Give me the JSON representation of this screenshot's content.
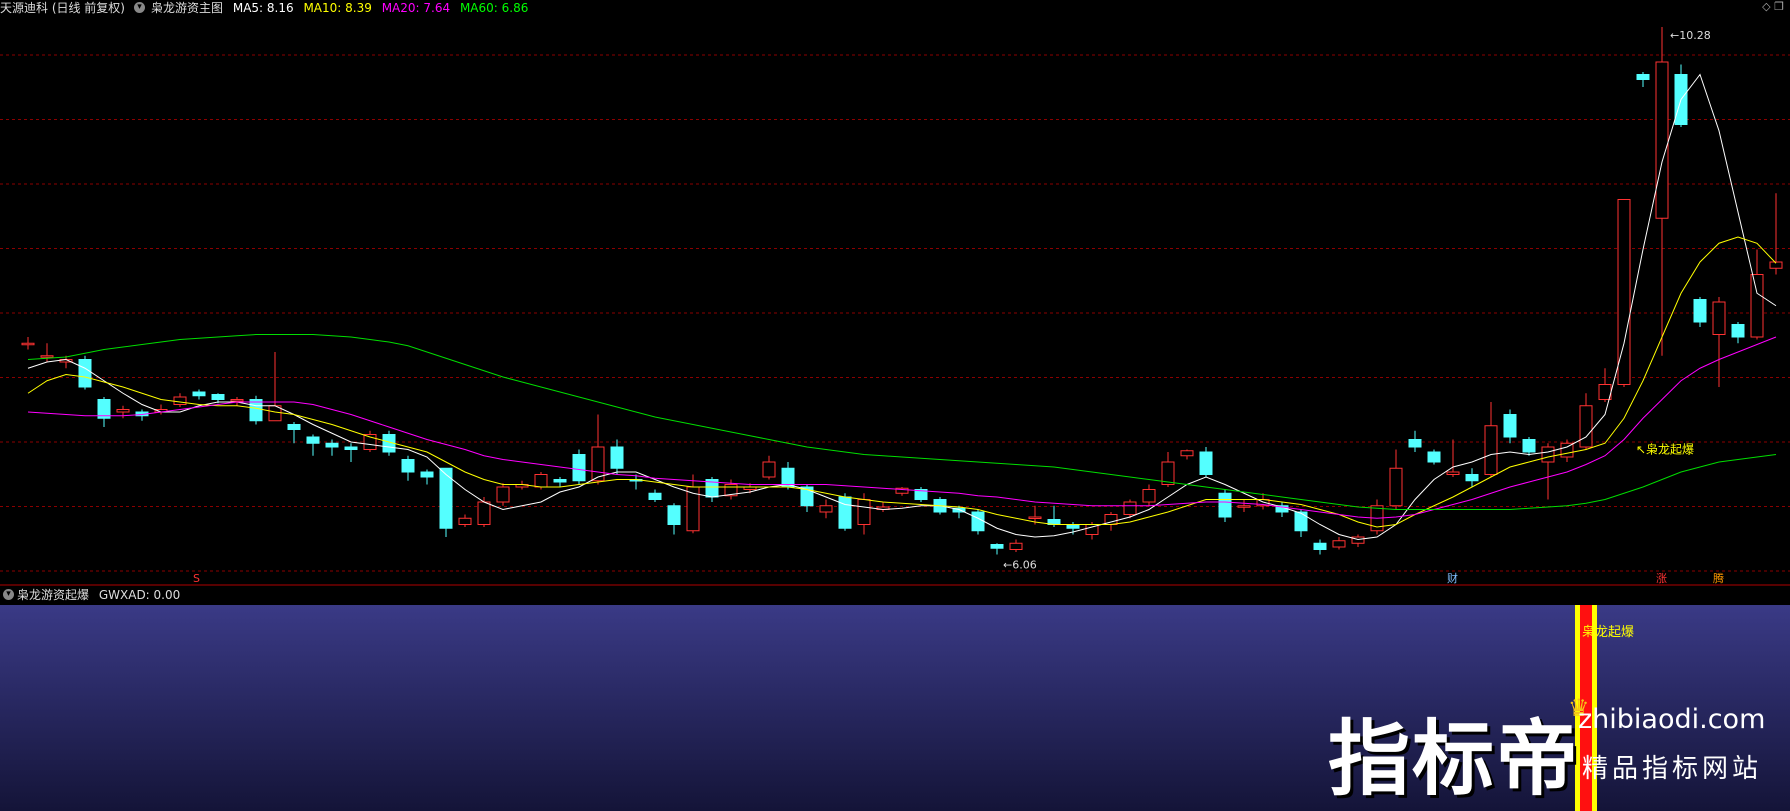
{
  "header": {
    "stock": "天源迪科 (日线 前复权)",
    "indicator": "枭龙游资主图",
    "ma5": {
      "label": "MA5: 8.16",
      "color": "#ffffff"
    },
    "ma10": {
      "label": "MA10: 8.39",
      "color": "#ffff00"
    },
    "ma20": {
      "label": "MA20: 7.64",
      "color": "#ff00ff"
    },
    "ma60": {
      "label": "MA60: 6.86",
      "color": "#00ff00"
    }
  },
  "corner_icons": [
    "diamond-icon",
    "window-icon"
  ],
  "sub_header": {
    "indicator": "枭龙游资起爆",
    "value": "GWXAD: 0.00"
  },
  "annotations": {
    "high": "10.28",
    "low": "6.06",
    "signal": "枭龙起爆",
    "sub_signal": "枭龙起爆",
    "marker_s": "S",
    "marker_cai": "财",
    "marker_zhang": "涨",
    "marker_sheng": "腾"
  },
  "watermark": {
    "brand": "指标帝",
    "url": "zhibiaodi.com",
    "slogan": "精品指标网站"
  },
  "colors": {
    "up": "#ff3232",
    "down": "#54ffff",
    "grid": "#8b0000",
    "signal": "#ffff00"
  },
  "chart_data": {
    "type": "candlestick",
    "ohlc": [
      [
        7.75,
        7.75,
        7.8,
        7.7
      ],
      [
        7.65,
        7.65,
        7.75,
        7.6
      ],
      [
        7.6,
        7.62,
        7.65,
        7.55
      ],
      [
        7.62,
        7.4,
        7.65,
        7.38
      ],
      [
        7.3,
        7.15,
        7.32,
        7.08
      ],
      [
        7.2,
        7.22,
        7.25,
        7.15
      ],
      [
        7.2,
        7.17,
        7.22,
        7.13
      ],
      [
        7.2,
        7.22,
        7.26,
        7.18
      ],
      [
        7.26,
        7.32,
        7.35,
        7.24
      ],
      [
        7.36,
        7.33,
        7.38,
        7.3
      ],
      [
        7.34,
        7.3,
        7.35,
        7.27
      ],
      [
        7.3,
        7.3,
        7.32,
        7.25
      ],
      [
        7.3,
        7.13,
        7.33,
        7.1
      ],
      [
        7.13,
        7.25,
        7.68,
        7.13
      ],
      [
        7.1,
        7.06,
        7.12,
        6.95
      ],
      [
        7.0,
        6.95,
        7.02,
        6.85
      ],
      [
        6.95,
        6.92,
        6.98,
        6.85
      ],
      [
        6.92,
        6.9,
        6.95,
        6.8
      ],
      [
        6.9,
        7.02,
        7.05,
        6.88
      ],
      [
        7.02,
        6.88,
        7.05,
        6.85
      ],
      [
        6.82,
        6.72,
        6.85,
        6.65
      ],
      [
        6.72,
        6.68,
        6.74,
        6.62
      ],
      [
        6.75,
        6.27,
        6.75,
        6.2
      ],
      [
        6.3,
        6.35,
        6.38,
        6.28
      ],
      [
        6.3,
        6.48,
        6.52,
        6.28
      ],
      [
        6.48,
        6.6,
        6.63,
        6.45
      ],
      [
        6.6,
        6.62,
        6.65,
        6.58
      ],
      [
        6.6,
        6.7,
        6.72,
        6.58
      ],
      [
        6.66,
        6.64,
        6.68,
        6.6
      ],
      [
        6.86,
        6.65,
        6.9,
        6.62
      ],
      [
        6.65,
        6.92,
        7.18,
        6.62
      ],
      [
        6.92,
        6.75,
        6.98,
        6.7
      ],
      [
        6.66,
        6.65,
        6.7,
        6.58
      ],
      [
        6.55,
        6.5,
        6.58,
        6.48
      ],
      [
        6.45,
        6.3,
        6.47,
        6.22
      ],
      [
        6.25,
        6.6,
        6.7,
        6.23
      ],
      [
        6.66,
        6.52,
        6.68,
        6.48
      ],
      [
        6.53,
        6.62,
        6.66,
        6.5
      ],
      [
        6.58,
        6.6,
        6.63,
        6.55
      ],
      [
        6.68,
        6.8,
        6.85,
        6.66
      ],
      [
        6.75,
        6.6,
        6.8,
        6.58
      ],
      [
        6.6,
        6.45,
        6.62,
        6.4
      ],
      [
        6.4,
        6.45,
        6.5,
        6.35
      ],
      [
        6.52,
        6.27,
        6.55,
        6.25
      ],
      [
        6.3,
        6.5,
        6.55,
        6.22
      ],
      [
        6.42,
        6.44,
        6.48,
        6.4
      ],
      [
        6.55,
        6.59,
        6.6,
        6.53
      ],
      [
        6.58,
        6.5,
        6.6,
        6.48
      ],
      [
        6.5,
        6.4,
        6.52,
        6.38
      ],
      [
        6.43,
        6.4,
        6.45,
        6.35
      ],
      [
        6.4,
        6.25,
        6.42,
        6.22
      ],
      [
        6.14,
        6.11,
        6.15,
        6.06
      ],
      [
        6.1,
        6.15,
        6.18,
        6.08
      ],
      [
        6.35,
        6.36,
        6.45,
        6.3
      ],
      [
        6.34,
        6.3,
        6.45,
        6.28
      ],
      [
        6.3,
        6.27,
        6.32,
        6.22
      ],
      [
        6.22,
        6.3,
        6.32,
        6.18
      ],
      [
        6.3,
        6.38,
        6.4,
        6.25
      ],
      [
        6.38,
        6.48,
        6.5,
        6.35
      ],
      [
        6.48,
        6.58,
        6.62,
        6.45
      ],
      [
        6.62,
        6.8,
        6.88,
        6.6
      ],
      [
        6.85,
        6.89,
        6.9,
        6.82
      ],
      [
        6.88,
        6.7,
        6.92,
        6.68
      ],
      [
        6.55,
        6.36,
        6.58,
        6.32
      ],
      [
        6.45,
        6.45,
        6.5,
        6.4
      ],
      [
        6.45,
        6.5,
        6.55,
        6.42
      ],
      [
        6.45,
        6.4,
        6.48,
        6.36
      ],
      [
        6.4,
        6.25,
        6.42,
        6.2
      ],
      [
        6.15,
        6.1,
        6.18,
        6.06
      ],
      [
        6.12,
        6.17,
        6.2,
        6.1
      ],
      [
        6.15,
        6.2,
        6.22,
        6.12
      ],
      [
        6.25,
        6.45,
        6.5,
        6.22
      ],
      [
        6.45,
        6.75,
        6.9,
        6.42
      ],
      [
        6.98,
        6.92,
        7.05,
        6.88
      ],
      [
        6.88,
        6.8,
        6.9,
        6.78
      ],
      [
        6.7,
        6.72,
        6.98,
        6.68
      ],
      [
        6.7,
        6.65,
        6.75,
        6.6
      ],
      [
        6.7,
        7.09,
        7.28,
        6.68
      ],
      [
        7.18,
        7.0,
        7.22,
        6.95
      ],
      [
        6.98,
        6.88,
        7.0,
        6.85
      ],
      [
        6.8,
        6.92,
        6.95,
        6.5
      ],
      [
        6.84,
        6.95,
        6.98,
        6.8
      ],
      [
        6.92,
        7.25,
        7.35,
        6.9
      ],
      [
        7.3,
        7.42,
        7.55,
        7.28
      ],
      [
        7.42,
        8.9,
        8.9,
        7.4
      ],
      [
        9.9,
        9.86,
        9.92,
        9.8
      ],
      [
        8.75,
        10.0,
        10.28,
        7.65
      ],
      [
        9.9,
        9.5,
        9.98,
        9.48
      ],
      [
        8.1,
        7.92,
        8.12,
        7.88
      ],
      [
        7.82,
        8.08,
        8.12,
        7.4
      ],
      [
        7.9,
        7.8,
        7.92,
        7.75
      ],
      [
        7.8,
        8.3,
        8.5,
        7.78
      ],
      [
        8.35,
        8.4,
        8.95,
        8.3
      ]
    ],
    "x_index": [
      0,
      1,
      2,
      3,
      4,
      5,
      6,
      7,
      8,
      9,
      10,
      11,
      12,
      13,
      14,
      15,
      16,
      17,
      18,
      19,
      20,
      21,
      22,
      23,
      24,
      25,
      26,
      27,
      28,
      29,
      30,
      31,
      32,
      33,
      34,
      35,
      36,
      37,
      38,
      39,
      40,
      41,
      42,
      43,
      44,
      45,
      46,
      47,
      48,
      49,
      50,
      51,
      52,
      53,
      54,
      55,
      56,
      57,
      58,
      59,
      60,
      61,
      62,
      63,
      64,
      65,
      66,
      67,
      68,
      69,
      70,
      71,
      72,
      73,
      74,
      75,
      76,
      77,
      78,
      79,
      80,
      81,
      82,
      83,
      84,
      85,
      86,
      87,
      88,
      89,
      90,
      91,
      92
    ],
    "series": [
      {
        "name": "MA5",
        "values": [
          7.55,
          7.6,
          7.62,
          7.55,
          7.45,
          7.35,
          7.26,
          7.2,
          7.2,
          7.25,
          7.28,
          7.28,
          7.25,
          7.25,
          7.18,
          7.1,
          7.03,
          6.96,
          6.94,
          6.92,
          6.9,
          6.84,
          6.7,
          6.58,
          6.48,
          6.42,
          6.45,
          6.48,
          6.56,
          6.6,
          6.68,
          6.72,
          6.72,
          6.66,
          6.6,
          6.55,
          6.52,
          6.54,
          6.56,
          6.6,
          6.62,
          6.58,
          6.52,
          6.46,
          6.44,
          6.42,
          6.43,
          6.45,
          6.45,
          6.42,
          6.35,
          6.27,
          6.22,
          6.2,
          6.21,
          6.24,
          6.28,
          6.32,
          6.36,
          6.42,
          6.52,
          6.62,
          6.68,
          6.62,
          6.55,
          6.48,
          6.44,
          6.39,
          6.3,
          6.22,
          6.18,
          6.2,
          6.3,
          6.5,
          6.66,
          6.76,
          6.8,
          6.86,
          6.88,
          6.86,
          6.88,
          6.92,
          7.0,
          7.18,
          7.75,
          8.5,
          9.2,
          9.7,
          9.9,
          9.45,
          8.8,
          8.15,
          8.05
        ]
      },
      {
        "name": "MA10",
        "values": [
          7.35,
          7.45,
          7.5,
          7.48,
          7.44,
          7.4,
          7.35,
          7.3,
          7.28,
          7.26,
          7.25,
          7.25,
          7.23,
          7.2,
          7.18,
          7.14,
          7.1,
          7.05,
          7.0,
          6.96,
          6.92,
          6.88,
          6.8,
          6.72,
          6.66,
          6.62,
          6.62,
          6.6,
          6.6,
          6.62,
          6.64,
          6.66,
          6.66,
          6.64,
          6.62,
          6.6,
          6.6,
          6.6,
          6.6,
          6.6,
          6.6,
          6.58,
          6.55,
          6.52,
          6.5,
          6.48,
          6.47,
          6.46,
          6.45,
          6.44,
          6.42,
          6.38,
          6.35,
          6.32,
          6.3,
          6.3,
          6.3,
          6.3,
          6.32,
          6.36,
          6.4,
          6.45,
          6.5,
          6.5,
          6.5,
          6.5,
          6.48,
          6.46,
          6.42,
          6.38,
          6.32,
          6.28,
          6.3,
          6.38,
          6.45,
          6.52,
          6.6,
          6.68,
          6.76,
          6.8,
          6.84,
          6.87,
          6.9,
          6.95,
          7.15,
          7.45,
          7.8,
          8.15,
          8.4,
          8.55,
          8.6,
          8.55,
          8.39
        ]
      },
      {
        "name": "MA20",
        "values": [
          7.2,
          7.19,
          7.18,
          7.17,
          7.17,
          7.17,
          7.18,
          7.2,
          7.22,
          7.24,
          7.26,
          7.28,
          7.28,
          7.28,
          7.28,
          7.26,
          7.22,
          7.18,
          7.13,
          7.08,
          7.03,
          6.98,
          6.94,
          6.9,
          6.85,
          6.82,
          6.8,
          6.78,
          6.76,
          6.74,
          6.72,
          6.7,
          6.69,
          6.67,
          6.66,
          6.65,
          6.64,
          6.63,
          6.62,
          6.62,
          6.62,
          6.62,
          6.62,
          6.61,
          6.6,
          6.59,
          6.58,
          6.57,
          6.56,
          6.55,
          6.53,
          6.52,
          6.5,
          6.48,
          6.47,
          6.46,
          6.45,
          6.45,
          6.45,
          6.45,
          6.46,
          6.47,
          6.48,
          6.48,
          6.47,
          6.46,
          6.44,
          6.42,
          6.4,
          6.38,
          6.36,
          6.35,
          6.36,
          6.38,
          6.42,
          6.46,
          6.5,
          6.55,
          6.6,
          6.64,
          6.68,
          6.72,
          6.78,
          6.85,
          6.98,
          7.15,
          7.3,
          7.45,
          7.55,
          7.62,
          7.68,
          7.74,
          7.8
        ]
      },
      {
        "name": "MA60",
        "values": [
          7.62,
          7.63,
          7.64,
          7.67,
          7.7,
          7.72,
          7.74,
          7.76,
          7.78,
          7.79,
          7.8,
          7.81,
          7.82,
          7.82,
          7.82,
          7.82,
          7.81,
          7.8,
          7.78,
          7.76,
          7.73,
          7.68,
          7.63,
          7.58,
          7.53,
          7.48,
          7.44,
          7.4,
          7.36,
          7.32,
          7.28,
          7.24,
          7.2,
          7.16,
          7.13,
          7.1,
          7.07,
          7.04,
          7.01,
          6.98,
          6.95,
          6.92,
          6.9,
          6.88,
          6.86,
          6.85,
          6.84,
          6.83,
          6.82,
          6.81,
          6.8,
          6.79,
          6.78,
          6.77,
          6.76,
          6.74,
          6.72,
          6.7,
          6.68,
          6.66,
          6.64,
          6.62,
          6.6,
          6.58,
          6.56,
          6.54,
          6.52,
          6.5,
          6.48,
          6.46,
          6.44,
          6.43,
          6.42,
          6.42,
          6.42,
          6.42,
          6.42,
          6.42,
          6.42,
          6.43,
          6.44,
          6.45,
          6.47,
          6.5,
          6.55,
          6.6,
          6.66,
          6.72,
          6.76,
          6.8,
          6.82,
          6.84,
          6.86
        ]
      }
    ],
    "ylim": [
      6.0,
      10.4
    ],
    "grid": true,
    "signals": {
      "s_index": 9,
      "cai_index": 75,
      "zhang_index": 86,
      "sheng_index": 89,
      "signal_index": 84
    }
  }
}
